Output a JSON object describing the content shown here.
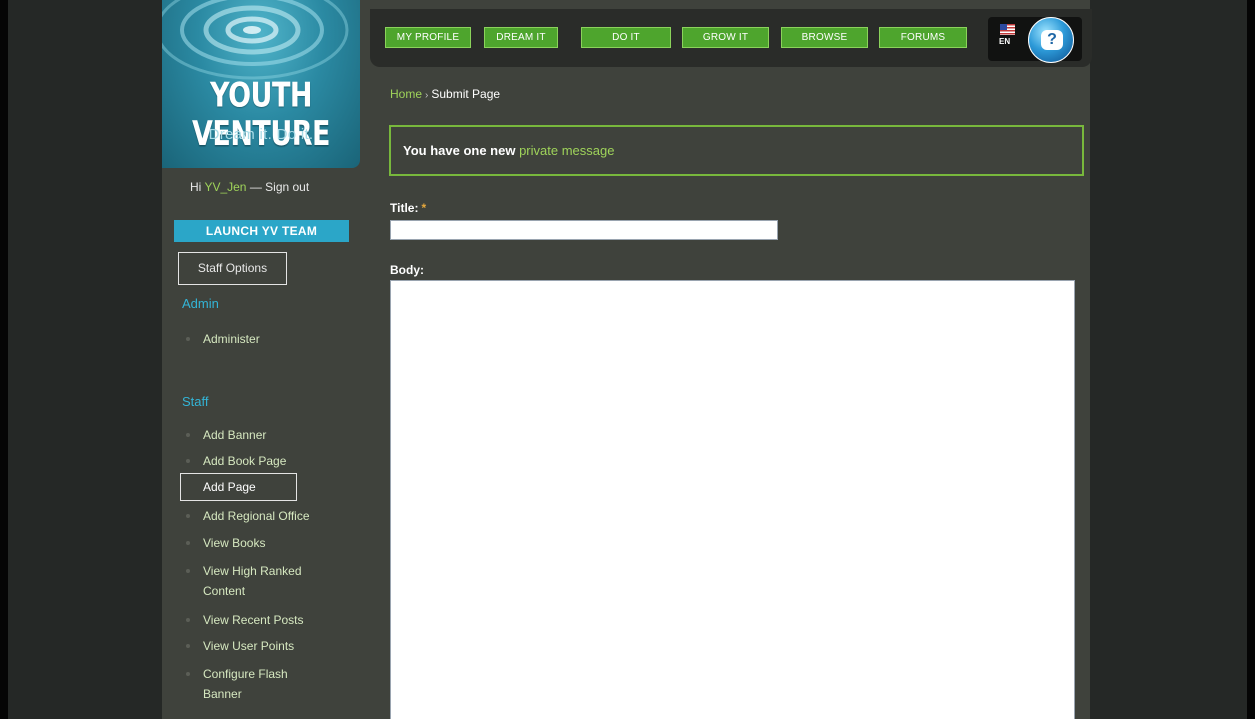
{
  "brand": {
    "title": "YOUTH VENTURE",
    "tagline": "Dream it. Do it."
  },
  "user": {
    "greeting": "Hi ",
    "username": "YV_Jen",
    "separator": " — ",
    "signout": "Sign out"
  },
  "sidebar": {
    "launch_label": "LAUNCH YV TEAM",
    "staff_options_label": "Staff Options",
    "admin_heading": "Admin",
    "admin_items": [
      {
        "label": "Administer"
      }
    ],
    "staff_heading": "Staff",
    "staff_items": [
      {
        "label": "Add Banner"
      },
      {
        "label": "Add Book Page"
      },
      {
        "label": "Add Page"
      },
      {
        "label": "Add Regional Office"
      },
      {
        "label": "View Books"
      },
      {
        "label": "View High Ranked Content"
      },
      {
        "label": "View Recent Posts"
      },
      {
        "label": "View User Points"
      },
      {
        "label": "Configure Flash Banner"
      }
    ]
  },
  "topnav": {
    "items": [
      {
        "label": "MY PROFILE"
      },
      {
        "label": "DREAM IT"
      },
      {
        "label": "DO IT"
      },
      {
        "label": "GROW IT"
      },
      {
        "label": "BROWSE"
      },
      {
        "label": "FORUMS"
      }
    ],
    "language_code": "EN",
    "help_glyph": "?"
  },
  "breadcrumb": {
    "home": "Home",
    "separator": "›",
    "current": "Submit Page"
  },
  "message": {
    "prefix": "You have one new",
    "link": "private message"
  },
  "form": {
    "title_label": "Title:",
    "required_marker": "*",
    "title_value": "",
    "body_label": "Body:",
    "body_value": ""
  },
  "colors": {
    "accent_green": "#4ea52d",
    "link_green": "#9fd35a",
    "accent_blue": "#2ba6c8",
    "page_bg": "#3f423c"
  },
  "icons": {
    "flag": "us-flag-icon",
    "help": "help-globe-icon"
  }
}
